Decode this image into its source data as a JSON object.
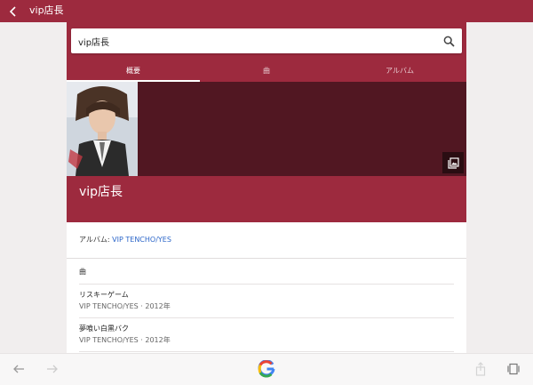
{
  "top_bar": {
    "title": "vip店長",
    "back_icon": "chevron-left-icon"
  },
  "search": {
    "value": "vip店長",
    "icon": "search-icon"
  },
  "tabs": [
    {
      "label": "概要",
      "active": true
    },
    {
      "label": "曲",
      "active": false
    },
    {
      "label": "アルバム",
      "active": false
    }
  ],
  "artist": {
    "name": "vip店長",
    "gallery_icon": "photo-gallery-icon"
  },
  "album": {
    "label": "アルバム: ",
    "link": "VIP TENCHO/YES"
  },
  "songs": {
    "header": "曲",
    "items": [
      {
        "title": "リスキーゲーム",
        "meta": "VIP TENCHO/YES · 2012年"
      },
      {
        "title": "夢喰い白黒バク",
        "meta": "VIP TENCHO/YES · 2012年"
      }
    ]
  },
  "bottom_bar": {
    "icons": [
      "back-arrow-icon",
      "forward-arrow-icon",
      "google-logo-icon",
      "share-icon",
      "tabs-icon"
    ]
  },
  "colors": {
    "brand": "#9d2a3e",
    "hero_dark": "#511722",
    "link": "#2c66c9"
  }
}
